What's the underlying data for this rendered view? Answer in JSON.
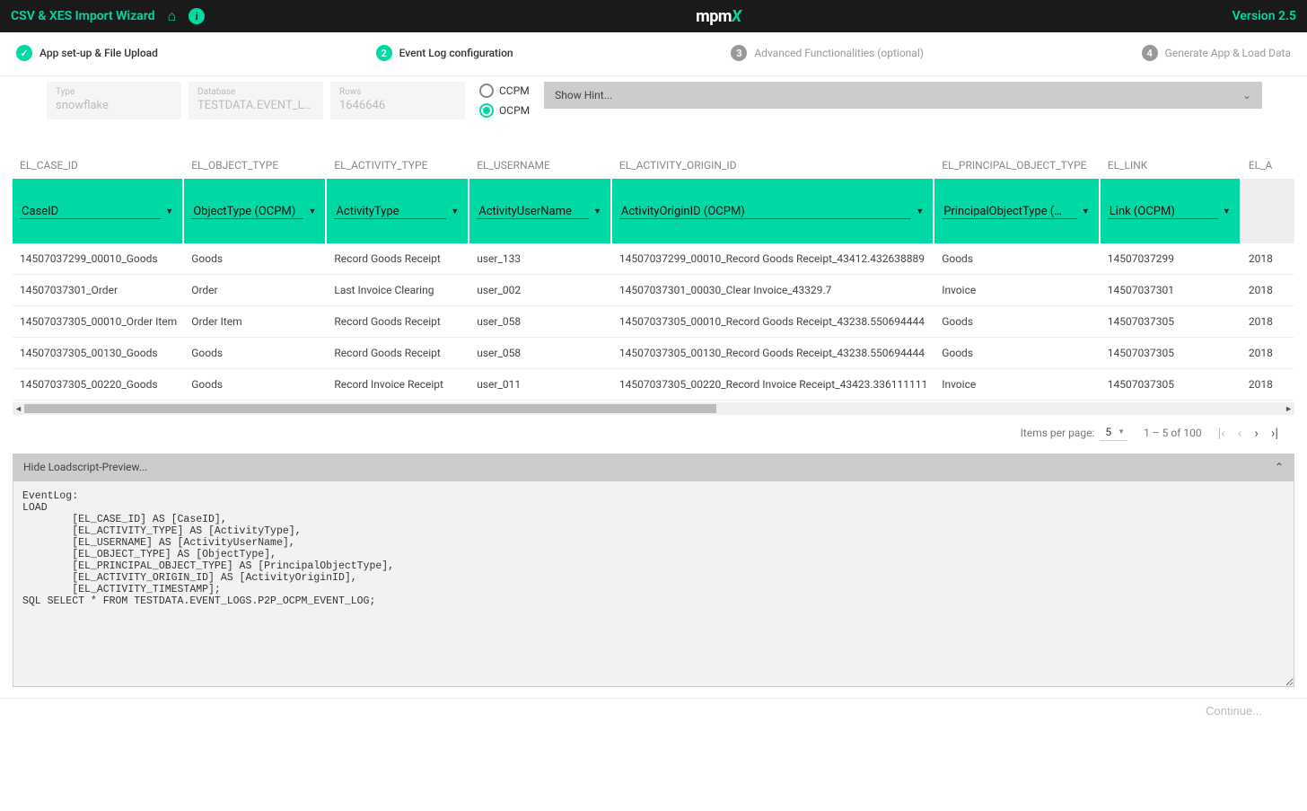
{
  "topbar": {
    "title": "CSV & XES Import Wizard",
    "version": "Version 2.5",
    "logo": "mpmX"
  },
  "stepper": {
    "s1": "App set-up & File Upload",
    "s2_num": "2",
    "s2": "Event Log configuration",
    "s3_num": "3",
    "s3": "Advanced Functionalities (optional)",
    "s4_num": "4",
    "s4": "Generate App & Load Data"
  },
  "fields": {
    "type_label": "Type",
    "type_value": "snowflake",
    "db_label": "Database",
    "db_value": "TESTDATA.EVENT_LOGS.",
    "rows_label": "Rows",
    "rows_value": "1646646"
  },
  "radio": {
    "ccpm": "CCPM",
    "ocpm": "OCPM"
  },
  "hint": "Show Hint...",
  "columns": [
    {
      "src": "EL_CASE_ID",
      "map": "CaseID",
      "w": "165"
    },
    {
      "src": "EL_OBJECT_TYPE",
      "map": "ObjectType (OCPM)",
      "w": "160"
    },
    {
      "src": "EL_ACTIVITY_TYPE",
      "map": "ActivityType",
      "w": "160"
    },
    {
      "src": "EL_USERNAME",
      "map": "ActivityUserName",
      "w": "160"
    },
    {
      "src": "EL_ACTIVITY_ORIGIN_ID",
      "map": "ActivityOriginID (OCPM)",
      "w": "315"
    },
    {
      "src": "EL_PRINCIPAL_OBJECT_TYPE",
      "map": "PrincipalObjectType (…",
      "w": "185"
    },
    {
      "src": "EL_LINK",
      "map": "Link (OCPM)",
      "w": "160"
    },
    {
      "src": "EL_A",
      "map": "",
      "w": "60"
    }
  ],
  "rows": [
    [
      "14507037299_00010_Goods",
      "Goods",
      "Record Goods Receipt",
      "user_133",
      "14507037299_00010_Record Goods Receipt_43412.432638889",
      "Goods",
      "14507037299",
      "2018"
    ],
    [
      "14507037301_Order",
      "Order",
      "Last Invoice Clearing",
      "user_002",
      "14507037301_00030_Clear Invoice_43329.7",
      "Invoice",
      "14507037301",
      "2018"
    ],
    [
      "14507037305_00010_Order Item",
      "Order Item",
      "Record Goods Receipt",
      "user_058",
      "14507037305_00010_Record Goods Receipt_43238.550694444",
      "Goods",
      "14507037305",
      "2018"
    ],
    [
      "14507037305_00130_Goods",
      "Goods",
      "Record Goods Receipt",
      "user_058",
      "14507037305_00130_Record Goods Receipt_43238.550694444",
      "Goods",
      "14507037305",
      "2018"
    ],
    [
      "14507037305_00220_Goods",
      "Goods",
      "Record Invoice Receipt",
      "user_011",
      "14507037305_00220_Record Invoice Receipt_43423.336111111",
      "Invoice",
      "14507037305",
      "2018"
    ]
  ],
  "paginator": {
    "label": "Items per page:",
    "per_page": "5",
    "range": "1 – 5 of 100"
  },
  "script": {
    "header": "Hide Loadscript-Preview...",
    "body": "EventLog:\nLOAD\n        [EL_CASE_ID] AS [CaseID],\n        [EL_ACTIVITY_TYPE] AS [ActivityType],\n        [EL_USERNAME] AS [ActivityUserName],\n        [EL_OBJECT_TYPE] AS [ObjectType],\n        [EL_PRINCIPAL_OBJECT_TYPE] AS [PrincipalObjectType],\n        [EL_ACTIVITY_ORIGIN_ID] AS [ActivityOriginID],\n        [EL_ACTIVITY_TIMESTAMP];\nSQL SELECT * FROM TESTDATA.EVENT_LOGS.P2P_OCPM_EVENT_LOG;"
  },
  "footer": {
    "continue": "Continue..."
  }
}
